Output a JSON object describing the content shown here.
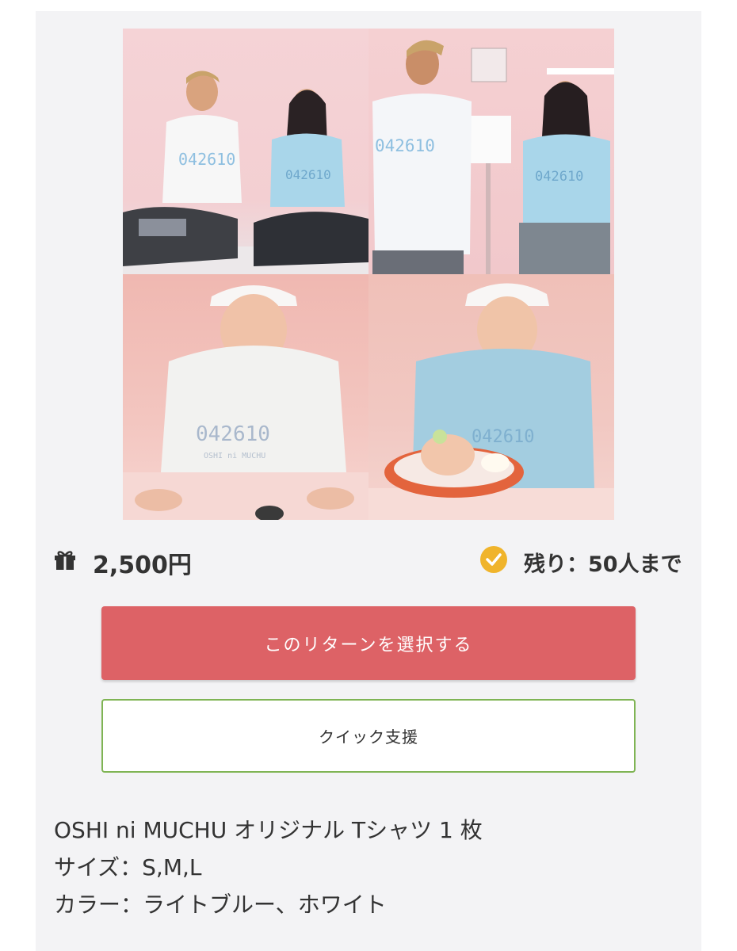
{
  "reward": {
    "price": "2,500円",
    "remaining": "残り：50人まで",
    "select_button_label": "このリターンを選択する",
    "quick_support_label": "クイック支援",
    "description_lines": [
      "OSHI ni MUCHU オリジナル Tシャツ 1 枚",
      "サイズ：S,M,L",
      "カラー：ライトブルー、ホワイト"
    ],
    "shirt_print": "042610",
    "shirt_sub_print": "OSHI ni MUCHU"
  },
  "colors": {
    "accent_red": "#dd6266",
    "quick_border_green": "#7fb454",
    "check_yellow": "#f0b42b",
    "shirt_light_blue": "#a9d6ea"
  },
  "icons": {
    "gift": "gift-icon",
    "check": "check-circle-icon"
  }
}
